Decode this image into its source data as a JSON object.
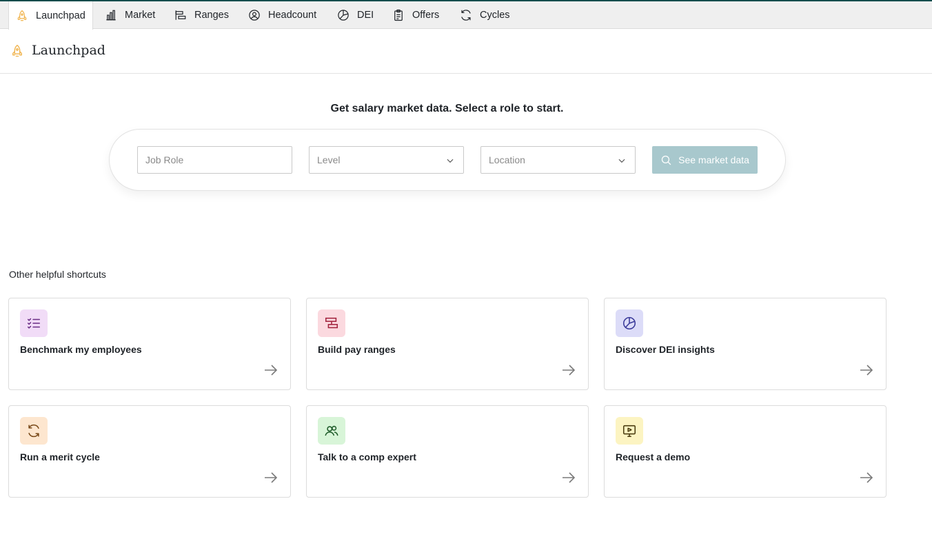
{
  "tabs": [
    {
      "label": "Launchpad",
      "icon": "rocket-icon",
      "active": true
    },
    {
      "label": "Market",
      "icon": "bar-chart-icon",
      "active": false
    },
    {
      "label": "Ranges",
      "icon": "ranges-icon",
      "active": false
    },
    {
      "label": "Headcount",
      "icon": "user-circle-icon",
      "active": false
    },
    {
      "label": "DEI",
      "icon": "pie-chart-icon",
      "active": false
    },
    {
      "label": "Offers",
      "icon": "clipboard-icon",
      "active": false
    },
    {
      "label": "Cycles",
      "icon": "refresh-icon",
      "active": false
    }
  ],
  "header": {
    "title": "Launchpad",
    "icon": "rocket-icon"
  },
  "search": {
    "prompt": "Get salary market data. Select a role to start.",
    "job_role_placeholder": "Job Role",
    "level_placeholder": "Level",
    "location_placeholder": "Location",
    "button_label": "See market data"
  },
  "shortcuts": {
    "heading": "Other helpful shortcuts",
    "items": [
      {
        "label": "Benchmark my employees",
        "icon": "checklist-icon",
        "tile_color": "#f1dcf7",
        "icon_color": "#6b2d86"
      },
      {
        "label": "Build pay ranges",
        "icon": "ranges-icon",
        "tile_color": "#fbd9df",
        "icon_color": "#a3243f"
      },
      {
        "label": "Discover DEI insights",
        "icon": "pie-chart-icon",
        "tile_color": "#dcdcf8",
        "icon_color": "#3a3a9a"
      },
      {
        "label": "Run a merit cycle",
        "icon": "refresh-icon",
        "tile_color": "#fde6cf",
        "icon_color": "#7a4a1a"
      },
      {
        "label": "Talk to a comp expert",
        "icon": "users-icon",
        "tile_color": "#d8f5d8",
        "icon_color": "#1f5c2a"
      },
      {
        "label": "Request a demo",
        "icon": "video-icon",
        "tile_color": "#fcf4c2",
        "icon_color": "#4a3d10"
      }
    ]
  },
  "colors": {
    "accent": "#0f4c4c",
    "button_disabled": "#a8c8cd",
    "rocket": "#f0b24a"
  }
}
